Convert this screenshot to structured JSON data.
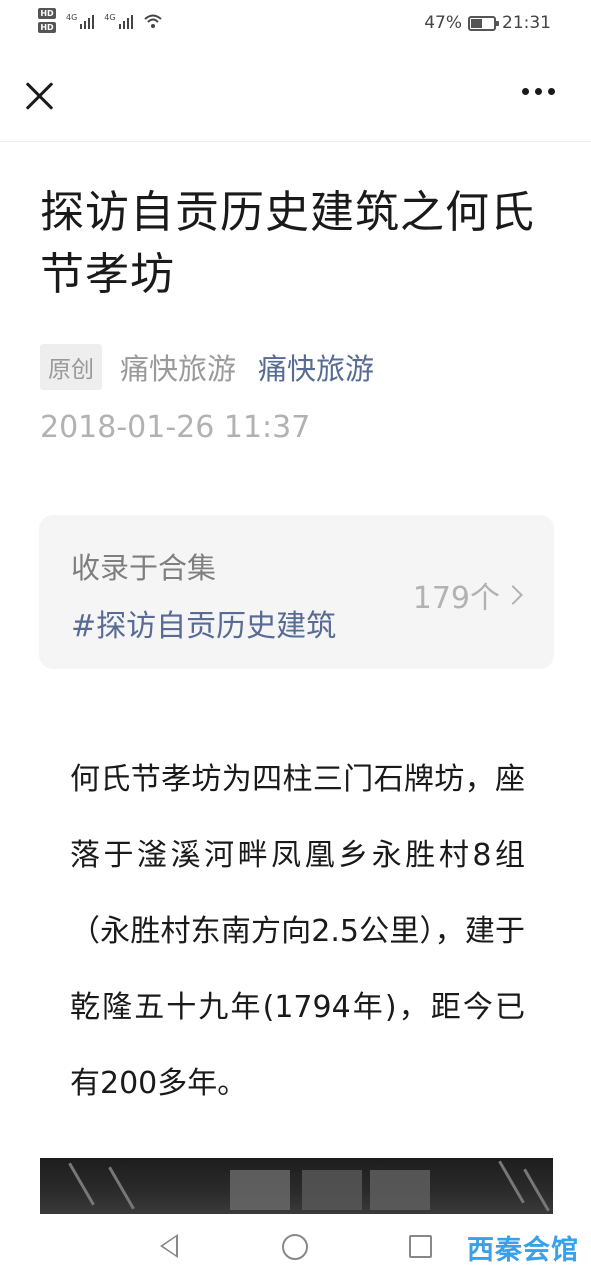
{
  "status_bar": {
    "hd1": "HD",
    "hd2": "HD",
    "net1": "4G",
    "net2": "4G",
    "battery": "47%",
    "battery_level": 0.47,
    "time": "21:31"
  },
  "nav": {
    "close_icon": "close-icon",
    "more_icon": "more-icon"
  },
  "article": {
    "title": "探访自贡历史建筑之何氏节孝坊",
    "original_tag": "原创",
    "author": "痛快旅游",
    "account": "痛快旅游",
    "date": "2018-01-26 11:37"
  },
  "collection": {
    "label": "收录于合集",
    "name": "#探访自贡历史建筑",
    "count": "179个"
  },
  "body": {
    "paragraph": "何氏节孝坊为四柱三门石牌坊，座落于滏溪河畔凤凰乡永胜村8组（永胜村东南方向2.5公里），建于乾隆五十九年(1794年)，距今已有200多年。"
  },
  "watermark": "西秦会馆",
  "colors": {
    "link": "#576b95",
    "muted": "#b2b2b2",
    "card_bg": "#f5f5f5",
    "watermark": "#3aa0e8"
  }
}
